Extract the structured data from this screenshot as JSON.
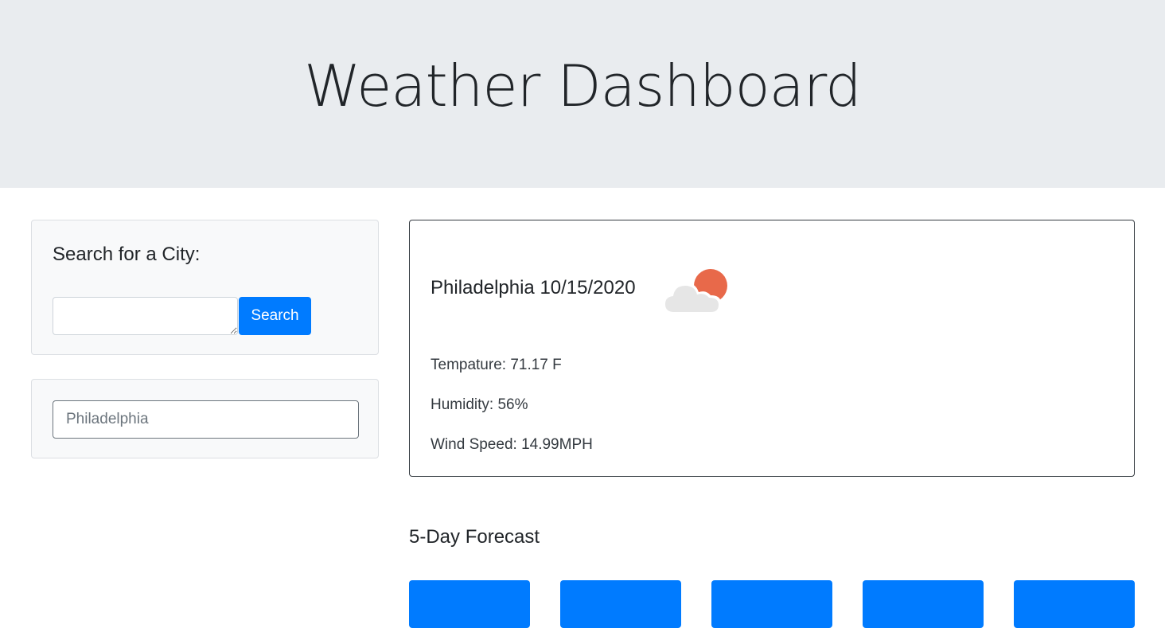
{
  "header": {
    "title": "Weather Dashboard"
  },
  "search": {
    "heading": "Search for a City:",
    "input_value": "",
    "button_label": "Search"
  },
  "history": {
    "items": [
      "Philadelphia"
    ]
  },
  "current": {
    "city": "Philadelphia",
    "date": "10/15/2020",
    "title": "Philadelphia 10/15/2020",
    "icon": "partly-cloudy-icon",
    "temperature": "Tempature: 71.17 F",
    "humidity": "Humidity: 56%",
    "wind": "Wind Speed: 14.99MPH"
  },
  "forecast": {
    "heading": "5-Day Forecast",
    "card_count": 5
  },
  "colors": {
    "accent": "#007bff",
    "header_bg": "#e9ecef",
    "sun": "#e8694a",
    "cloud": "#e6e6e6"
  }
}
